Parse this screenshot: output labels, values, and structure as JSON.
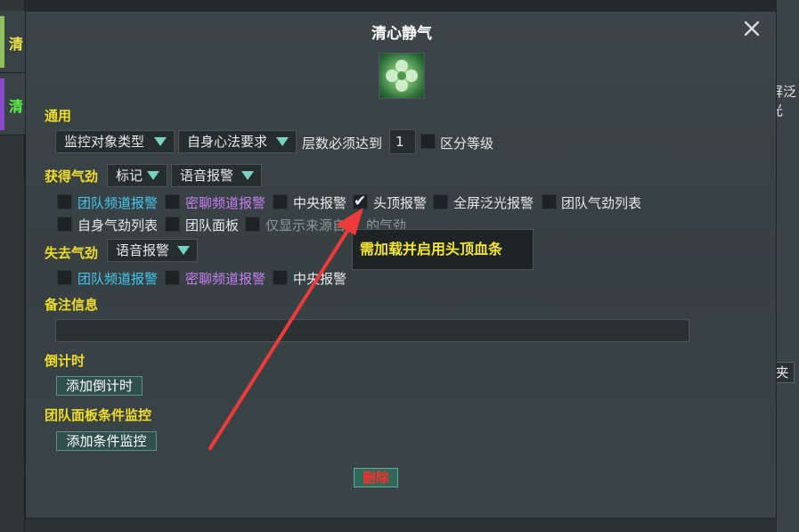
{
  "background": {
    "left_items": [
      "清",
      "清"
    ],
    "right_text": "屏泛光",
    "right_box": "夹"
  },
  "dialog": {
    "title": "清心静气",
    "close_icon": "close-icon",
    "skill_icon": "green-flower-skill-icon"
  },
  "general": {
    "heading": "通用",
    "monitor_type": "监控对象类型",
    "mind_method": "自身心法要求",
    "stack_label": "层数必须达到",
    "stack_value": "1",
    "distinguish_level": "区分等级",
    "distinguish_checked": false
  },
  "gain": {
    "heading": "获得气劲",
    "dropdown_mark": "标记",
    "dropdown_voice": "语音报警",
    "checkboxes": [
      {
        "label": "团队频道报警",
        "checked": false
      },
      {
        "label": "密聊频道报警",
        "checked": false
      },
      {
        "label": "中央报警",
        "checked": false
      },
      {
        "label": "头顶报警",
        "checked": true
      },
      {
        "label": "全屏泛光报警",
        "checked": false
      },
      {
        "label": "团队气劲列表",
        "checked": false
      },
      {
        "label": "自身气劲列表",
        "checked": false
      },
      {
        "label": "团队面板",
        "checked": false
      },
      {
        "label": "仅显示来源自",
        "checked": false
      },
      {
        "label": "的气劲",
        "checked": false
      }
    ]
  },
  "lose": {
    "heading": "失去气劲",
    "dropdown_voice": "语音报警",
    "checkboxes": [
      {
        "label": "团队频道报警",
        "checked": false
      },
      {
        "label": "密聊频道报警",
        "checked": false
      },
      {
        "label": "中央报警",
        "checked": false
      }
    ]
  },
  "tooltip": "需加载并启用头顶血条",
  "remark": {
    "heading": "备注信息",
    "value": ""
  },
  "countdown": {
    "heading": "倒计时",
    "button": "添加倒计时"
  },
  "team_panel": {
    "heading": "团队面板条件监控",
    "button": "添加条件监控"
  },
  "delete_button": "删除",
  "colors": {
    "section_heading": "#f0dc2a",
    "team_channel": "#45c7f0",
    "private_channel": "#c67ef4",
    "delete_text": "#ff2a2a",
    "annotation_arrow": "#ee3a3a"
  }
}
